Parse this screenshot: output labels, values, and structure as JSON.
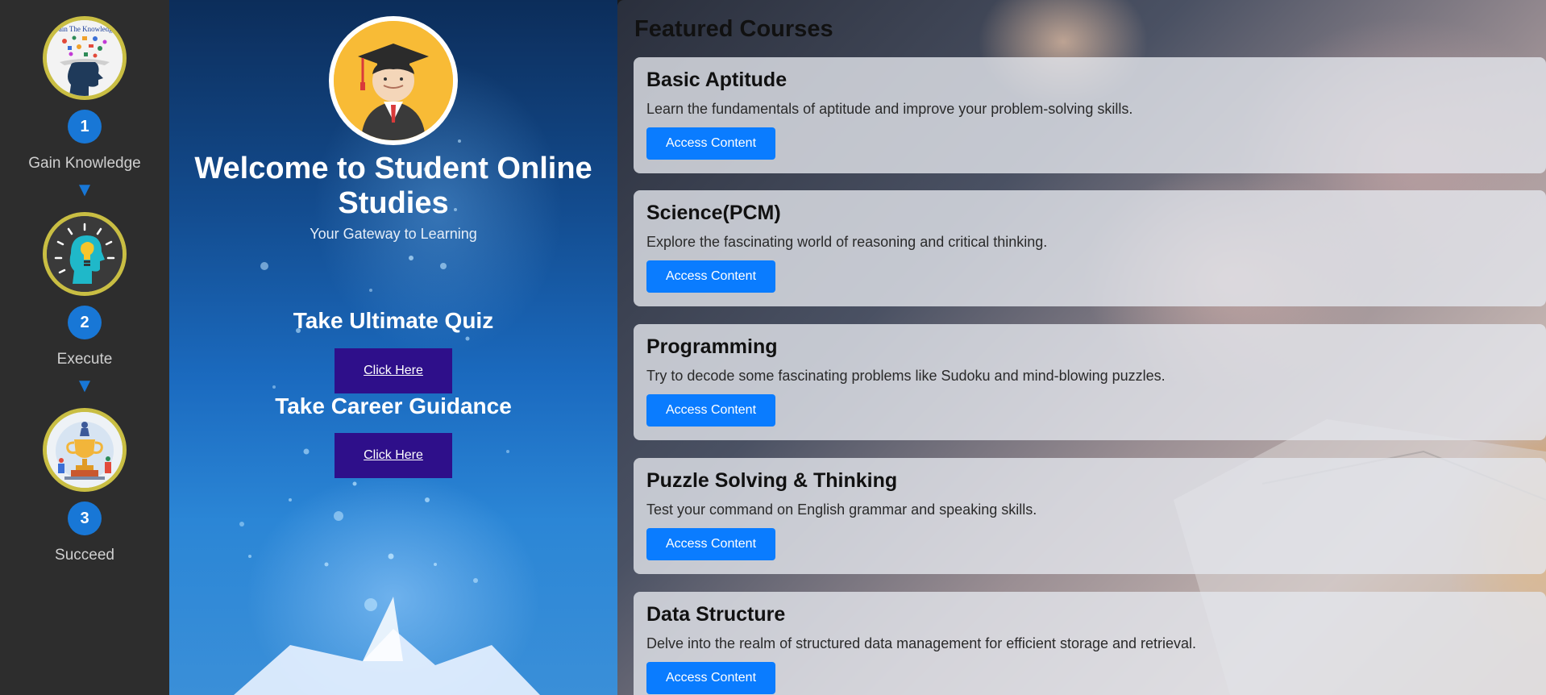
{
  "steps": [
    {
      "number": "1",
      "label": "Gain Knowledge",
      "image_text": "Gain The Knowledge",
      "icon": "head-knowledge-icon"
    },
    {
      "number": "2",
      "label": "Execute",
      "icon": "lightbulb-head-icon"
    },
    {
      "number": "3",
      "label": "Succeed",
      "icon": "trophy-success-icon"
    }
  ],
  "arrow": "▼",
  "hero": {
    "title": "Welcome to Student Online Studies",
    "subtitle": "Your Gateway to Learning",
    "quiz_heading": "Take Ultimate Quiz",
    "quiz_button": "Click Here",
    "career_heading": "Take Career Guidance",
    "career_button": "Click Here",
    "avatar_icon": "graduate-student-icon"
  },
  "featured": {
    "title": "Featured Courses",
    "courses": [
      {
        "title": "Basic Aptitude",
        "description": "Learn the fundamentals of aptitude and improve your problem-solving skills.",
        "button": "Access Content"
      },
      {
        "title": "Science(PCM)",
        "description": "Explore the fascinating world of reasoning and critical thinking.",
        "button": "Access Content"
      },
      {
        "title": "Programming",
        "description": "Try to decode some fascinating problems like Sudoku and mind-blowing puzzles.",
        "button": "Access Content"
      },
      {
        "title": "Puzzle Solving & Thinking",
        "description": "Test your command on English grammar and speaking skills.",
        "button": "Access Content"
      },
      {
        "title": "Data Structure",
        "description": "Delve into the realm of structured data management for efficient storage and retrieval.",
        "button": "Access Content"
      }
    ]
  },
  "colors": {
    "sidebar_bg": "#2d2d2d",
    "step_number_bg": "#1877d6",
    "step_ring": "#c9be43",
    "hero_button_bg": "#2e0f8a",
    "access_button_bg": "#0a7cff"
  }
}
